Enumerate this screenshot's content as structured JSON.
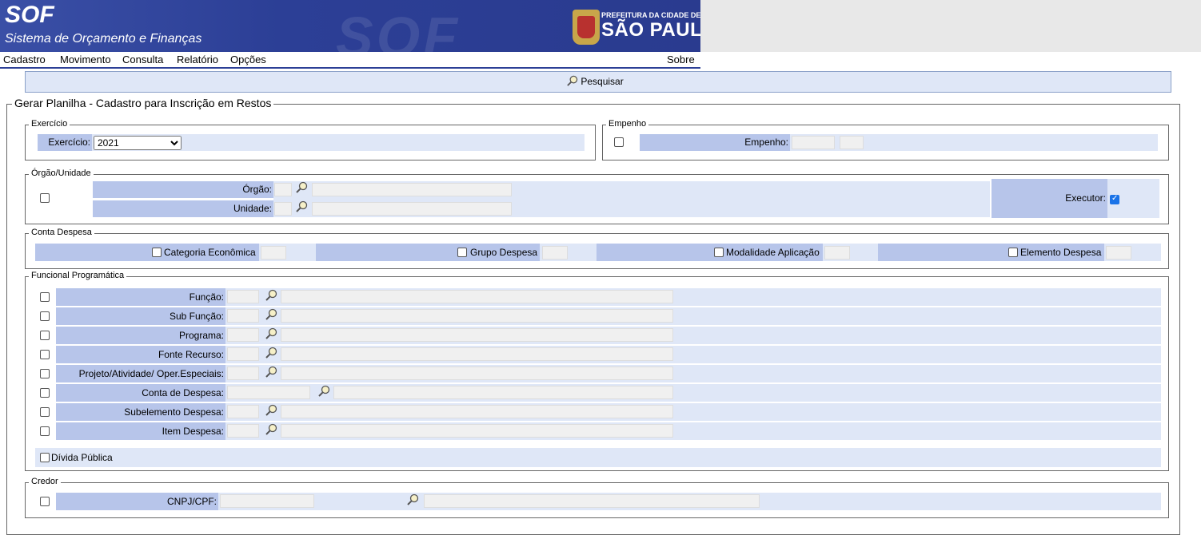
{
  "header": {
    "app_abbr": "SOF",
    "app_name": "Sistema de Orçamento e Finanças",
    "logo_small": "PREFEITURA DA CIDADE DE",
    "logo_big": "SÃO PAULO"
  },
  "menu": {
    "items": [
      "Cadastro",
      "Movimento",
      "Consulta",
      "Relatório",
      "Opções"
    ],
    "about": "Sobre"
  },
  "toolbar": {
    "search_label": "Pesquisar"
  },
  "form": {
    "title": "Gerar Planilha - Cadastro para Inscrição em Restos",
    "exercicio": {
      "legend": "Exercício",
      "label": "Exercício:",
      "value": "2021"
    },
    "empenho": {
      "legend": "Empenho",
      "label": "Empenho:"
    },
    "orgao": {
      "legend": "Órgão/Unidade",
      "orgao_label": "Órgão:",
      "unidade_label": "Unidade:",
      "executor_label": "Executor:"
    },
    "conta": {
      "legend": "Conta Despesa",
      "categoria": "Categoria Econômica",
      "grupo": "Grupo Despesa",
      "modalidade": "Modalidade Aplicação",
      "elemento": "Elemento Despesa"
    },
    "funcional": {
      "legend": "Funcional Programática",
      "rows": [
        "Função:",
        "Sub Função:",
        "Programa:",
        "Fonte Recurso:",
        "Projeto/Atividade/ Oper.Especiais:",
        "Conta de Despesa:",
        "Subelemento Despesa:",
        "Item Despesa:"
      ],
      "divida": "Dívida Pública"
    },
    "credor": {
      "legend": "Credor",
      "label": "CNPJ/CPF:"
    }
  },
  "colors": {
    "header_blue": "#2c3f96",
    "label_blue": "#b7c5ea",
    "light_blue": "#dfe7f7"
  },
  "icons": {
    "search": "magnifier-icon"
  }
}
